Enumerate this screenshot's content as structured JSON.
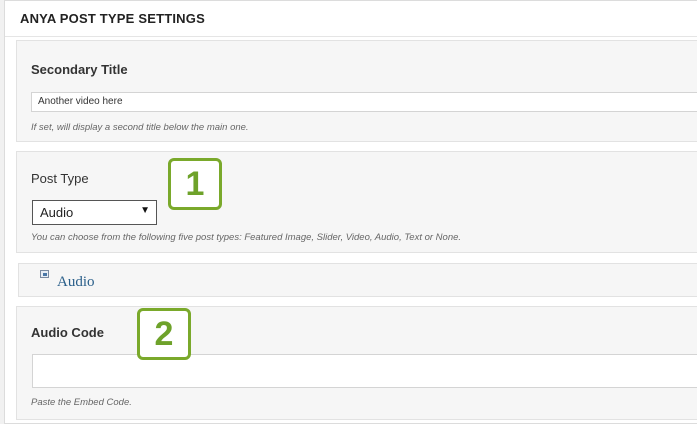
{
  "panel": {
    "title": "ANYA POST TYPE SETTINGS"
  },
  "secondary_title": {
    "label": "Secondary Title",
    "value": "Another video here",
    "hint": "If set, will display a second title below the main one."
  },
  "post_type": {
    "label": "Post Type",
    "selected": "Audio",
    "hint": "You can choose from the following five post types: Featured Image, Slider, Video, Audio, Text or None."
  },
  "audio_section": {
    "title": "Audio",
    "icon": "image-icon"
  },
  "audio_code": {
    "label": "Audio Code",
    "value": "",
    "hint": "Paste the Embed Code."
  },
  "annotations": [
    "1",
    "2"
  ],
  "colors": {
    "badge": "#7aa92b",
    "section_title": "#2a5f8a"
  }
}
